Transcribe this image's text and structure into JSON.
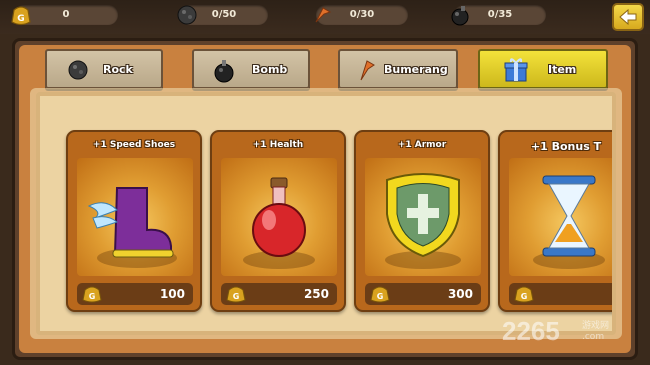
{
  "stats": [
    {
      "icon": "gold-coin-icon",
      "value": "0"
    },
    {
      "icon": "rock-icon",
      "value": "0/50"
    },
    {
      "icon": "boomerang-icon",
      "value": "0/30"
    },
    {
      "icon": "bomb-icon",
      "value": "0/35"
    }
  ],
  "back_icon": "back-arrow-icon",
  "tabs": [
    {
      "label": "Rock",
      "icon": "rock-icon"
    },
    {
      "label": "Bomb",
      "icon": "bomb-icon"
    },
    {
      "label": "Bumerang",
      "icon": "boomerang-icon"
    },
    {
      "label": "Item",
      "icon": "gift-box-icon",
      "active": true
    }
  ],
  "items": [
    {
      "title": "+1 Speed Shoes",
      "icon": "winged-boot-icon",
      "price": "100"
    },
    {
      "title": "+1 Health",
      "icon": "red-potion-icon",
      "price": "250"
    },
    {
      "title": "+1 Armor",
      "icon": "shield-icon",
      "price": "300"
    },
    {
      "title": "+1 Bonus T",
      "icon": "hourglass-icon",
      "price": ""
    }
  ],
  "watermark": {
    "text": "2265",
    "sub1": "游戏网",
    "sub2": ".com"
  },
  "colors": {
    "accent_tab": "#e6d12c",
    "card": "#b8681c",
    "parchment": "#ecd3a2"
  }
}
